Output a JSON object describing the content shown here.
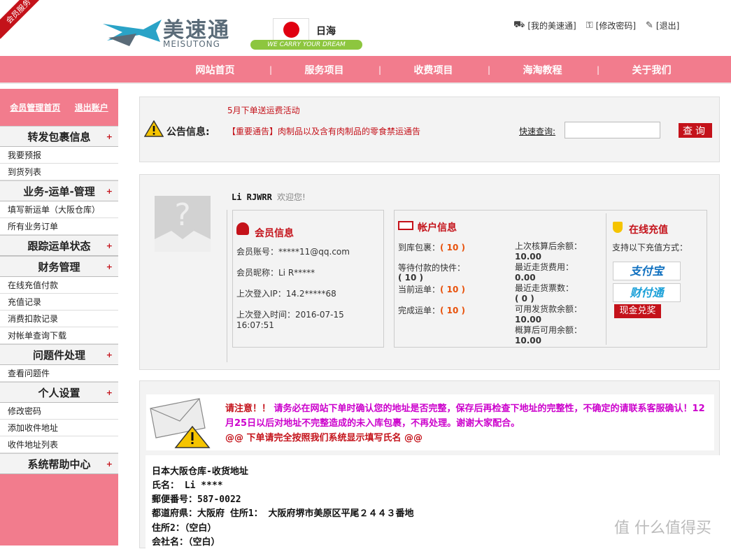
{
  "header": {
    "corner_badge": "会员服务",
    "logo_cn": "美速通",
    "logo_en": "MEISUTONG",
    "region": "日海",
    "slogan": "WE CARRY YOUR DREAM",
    "links": [
      {
        "label": "[我的美速通]",
        "icon": "truck-icon"
      },
      {
        "label": "[修改密码]",
        "icon": "key-icon"
      },
      {
        "label": "[退出]",
        "icon": "edit-icon"
      }
    ]
  },
  "nav": [
    "网站首页",
    "服务项目",
    "收费项目",
    "海淘教程",
    "关于我们"
  ],
  "nav_sep": "|",
  "sidebar": {
    "top_links": [
      "会员管理首页",
      "退出账户"
    ],
    "sections": [
      {
        "title": "转发包裹信息",
        "items": [
          "我要预报",
          "到货列表"
        ]
      },
      {
        "title": "业务-运单-管理",
        "items": [
          "填写新运单（大阪仓库）",
          "所有业务订单"
        ]
      },
      {
        "title": "跟踪运单状态",
        "items": []
      },
      {
        "title": "财务管理",
        "items": [
          "在线充值付款",
          "充值记录",
          "消费扣款记录",
          "对帐单查询下载"
        ]
      },
      {
        "title": "问题件处理",
        "items": [
          "查看问题件"
        ]
      },
      {
        "title": "个人设置",
        "items": [
          "修改密码",
          "添加收件地址",
          "收件地址列表"
        ]
      },
      {
        "title": "系统帮助中心",
        "items": []
      }
    ],
    "plus": "+"
  },
  "notice": {
    "label": "公告信息:",
    "line1": "5月下单送运费活动",
    "line2": "【重要通告】肉制品以及含有肉制品的零食禁运通告",
    "quick_label": "快速查询:",
    "quick_placeholder": "",
    "query_button": "查询"
  },
  "member": {
    "name": "Li RJWRR",
    "welcome": "欢迎您!",
    "info_title": "会员信息",
    "account": "会员账号：*****11@qq.com",
    "nickname": "会员昵称：Li R*****",
    "last_ip": "上次登入IP：14.2*****68",
    "last_time": "上次登入时间：2016-07-15 16:07:51",
    "account_title": "帐户信息",
    "arrived_label": "到库包裹：",
    "arrived": "( 10 )",
    "waiting_label": "等待付款的快件：",
    "waiting": "( 10 )",
    "current_label": "当前运单：",
    "current": "( 10 )",
    "done_label": "完成运单：",
    "done": "( 10 )",
    "bal_label": "上次核算后余额：",
    "bal": "10.00",
    "fee_label": "最近走货费用：",
    "fee": "0.00",
    "count_label": "最近走货票数：",
    "count": "( 0 )",
    "avail_label": "可用发货款余额：",
    "avail": "10.00",
    "est_label": "概算后可用余额：",
    "est": "10.00",
    "recharge_title": "在线充值",
    "recharge_sub": "支持以下充值方式：",
    "alipay": "支付宝",
    "tenpay": "财付通",
    "cash": "现金兑奖"
  },
  "alert": {
    "lead": "请注意！！",
    "body": "请务必在网站下单时确认您的地址是否完整，保存后再检查下地址的完整性，不确定的请联系客服确认！12月25日以后对地址不完整造成的未入库包裹，不再处理。谢谢大家配合。",
    "line3": "@@ 下单请完全按照我们系统显示填写氏名 @@"
  },
  "address": {
    "title": "日本大阪仓库-收货地址",
    "name": "氏名： Li ****",
    "zip": "郵便番号：587-0022",
    "pref": "都道府県：大阪府 住所1： 大阪府堺市美原区平尾２４４３番地",
    "addr2": "住所2：（空白）",
    "company": "会社名：（空白）"
  },
  "watermark": "值 什么值得买"
}
